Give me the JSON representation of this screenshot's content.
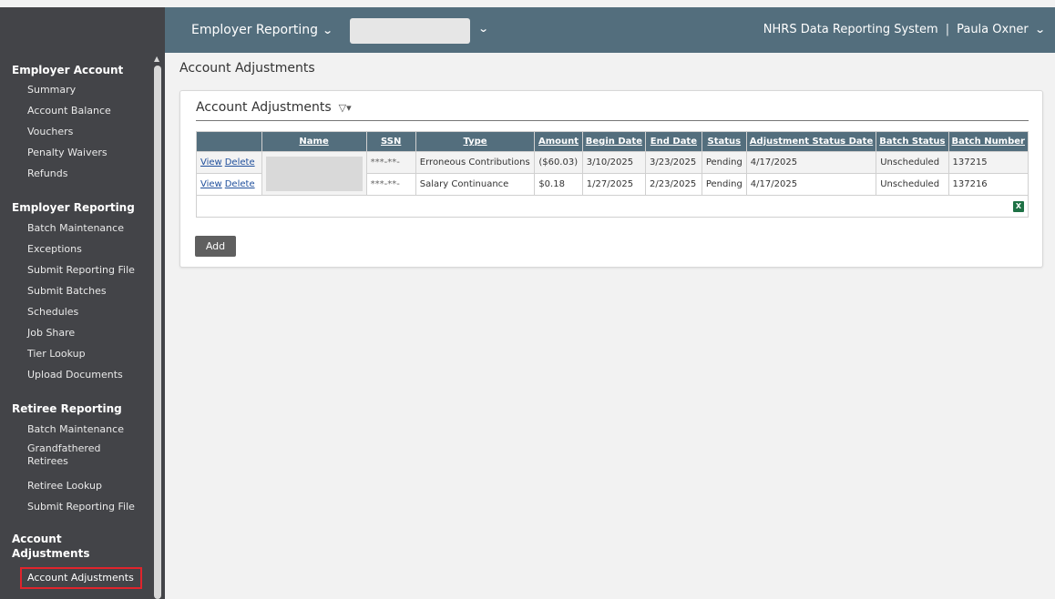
{
  "topbar": {
    "menu_label": "Employer Reporting",
    "system_name": "NHRS Data Reporting System",
    "separator": "|",
    "user_name": "Paula Oxner"
  },
  "sidebar": {
    "sections": [
      {
        "title": "Employer Account",
        "items": [
          "Summary",
          "Account Balance",
          "Vouchers",
          "Penalty Waivers",
          "Refunds"
        ]
      },
      {
        "title": "Employer Reporting",
        "items": [
          "Batch Maintenance",
          "Exceptions",
          "Submit Reporting File",
          "Submit Batches",
          "Schedules",
          "Job Share",
          "Tier Lookup",
          "Upload Documents"
        ]
      },
      {
        "title": "Retiree Reporting",
        "items": [
          "Batch Maintenance",
          "Grandfathered Retirees",
          "Retiree Lookup",
          "Submit Reporting File"
        ]
      },
      {
        "title": "Account Adjustments",
        "items": [
          "Account Adjustments"
        ]
      }
    ]
  },
  "page": {
    "title": "Account Adjustments",
    "panel_title": "Account Adjustments"
  },
  "table": {
    "headers": [
      "Name",
      "SSN",
      "Type",
      "Amount",
      "Begin Date",
      "End Date",
      "Status",
      "Adjustment Status Date",
      "Batch Status",
      "Batch Number"
    ],
    "rows": [
      {
        "view": "View",
        "delete": "Delete",
        "ssn_mask": "***-**-",
        "type": "Erroneous Contributions",
        "amount": "($60.03)",
        "begin": "3/10/2025",
        "end": "3/23/2025",
        "status": "Pending",
        "adj_date": "4/17/2025",
        "batch_status": "Unscheduled",
        "batch_number": "137215"
      },
      {
        "view": "View",
        "delete": "Delete",
        "ssn_mask": "***-**-",
        "type": "Salary Continuance",
        "amount": "$0.18",
        "begin": "1/27/2025",
        "end": "2/23/2025",
        "status": "Pending",
        "adj_date": "4/17/2025",
        "batch_status": "Unscheduled",
        "batch_number": "137216"
      }
    ]
  },
  "buttons": {
    "add": "Add"
  },
  "icons": {
    "excel": "excel-export-icon",
    "filter": "filter-icon",
    "chevron": "chevron-down-icon"
  },
  "colors": {
    "header_bar": "#536e7d",
    "sidebar": "#434448",
    "active_outline": "#e0242c"
  }
}
